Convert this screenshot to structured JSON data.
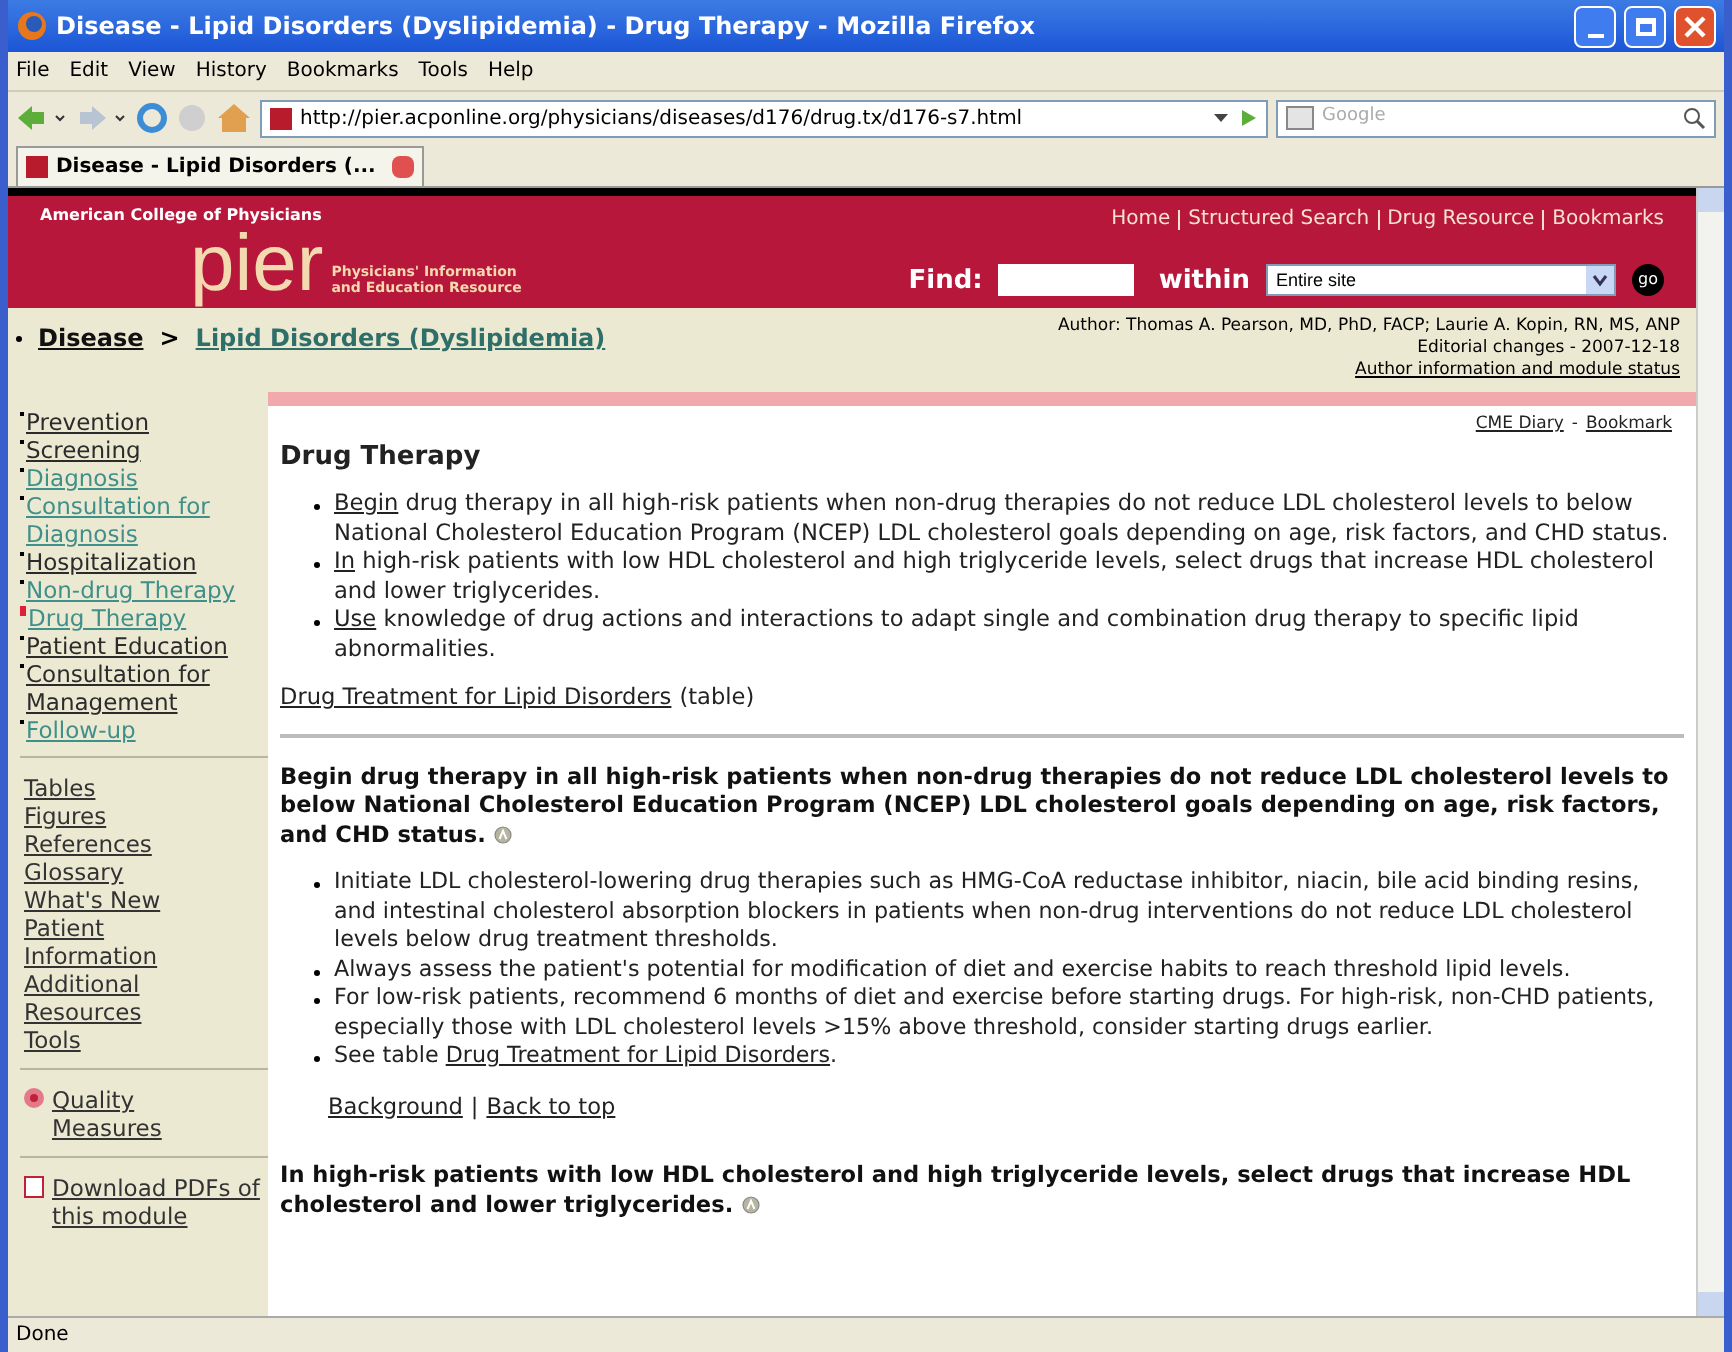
{
  "window": {
    "title": "Disease - Lipid Disorders (Dyslipidemia) - Drug Therapy - Mozilla Firefox"
  },
  "menu": [
    "File",
    "Edit",
    "View",
    "History",
    "Bookmarks",
    "Tools",
    "Help"
  ],
  "toolbar": {
    "url": "http://pier.acponline.org/physicians/diseases/d176/drug.tx/d176-s7.html",
    "search_placeholder": "Google"
  },
  "tabs": [
    {
      "label": "Disease - Lipid Disorders (...",
      "selected": true
    }
  ],
  "header": {
    "org": "American College of Physicians",
    "logo": "pier",
    "tagline": [
      "Physicians' Information",
      "and Education Resource"
    ],
    "top_links": [
      "Home",
      "Structured Search",
      "Drug Resource",
      "Bookmarks"
    ],
    "find_label": "Find:",
    "within_label": "within",
    "scope": "Entire site",
    "go": "go"
  },
  "breadcrumb": {
    "parent": "Disease",
    "separator": ">",
    "current": "Lipid Disorders (Dyslipidemia)"
  },
  "module_info": {
    "author": "Author: Thomas A. Pearson, MD, PhD, FACP; Laurie A. Kopin, RN, MS, ANP",
    "changes": "Editorial changes - 2007-12-18",
    "status_link": "Author information and module status"
  },
  "sidebar": {
    "sections": [
      {
        "label": "Prevention",
        "visited": true,
        "selected": false
      },
      {
        "label": "Screening",
        "visited": true,
        "selected": false
      },
      {
        "label": "Diagnosis",
        "visited": false,
        "selected": false
      },
      {
        "label": "Consultation for Diagnosis",
        "visited": false,
        "selected": false
      },
      {
        "label": "Hospitalization",
        "visited": true,
        "selected": false
      },
      {
        "label": "Non-drug Therapy",
        "visited": false,
        "selected": false
      },
      {
        "label": "Drug Therapy",
        "visited": false,
        "selected": true
      },
      {
        "label": "Patient Education",
        "visited": true,
        "selected": false
      },
      {
        "label": "Consultation for Management",
        "visited": true,
        "selected": false
      },
      {
        "label": "Follow-up",
        "visited": false,
        "selected": false
      }
    ],
    "resources": [
      "Tables",
      "Figures",
      "References",
      "Glossary",
      "What's New",
      "Patient Information",
      "Additional Resources",
      "Tools"
    ],
    "quality": "Quality Measures",
    "download": "Download PDFs of this module"
  },
  "content": {
    "utility_links": [
      "CME Diary",
      "Bookmark"
    ],
    "utility_separator": "-",
    "title": "Drug Therapy",
    "summary": [
      {
        "link": "Begin",
        "text": " drug therapy in all high-risk patients when non-drug therapies do not reduce LDL cholesterol levels to below National Cholesterol Education Program (NCEP) LDL cholesterol goals depending on age, risk factors, and CHD status."
      },
      {
        "link": "In",
        "text": " high-risk patients with low HDL cholesterol and high triglyceride levels, select drugs that increase HDL cholesterol and lower triglycerides."
      },
      {
        "link": "Use",
        "text": " knowledge of drug actions and interactions to adapt single and combination drug therapy to specific lipid abnormalities."
      }
    ],
    "table_link": "Drug Treatment for Lipid Disorders",
    "table_note": "(table)",
    "recommendations": [
      {
        "heading": "Begin drug therapy in all high-risk patients when non-drug therapies do not reduce LDL cholesterol levels to below National Cholesterol Education Program (NCEP) LDL cholesterol goals depending on age, risk factors, and CHD status.",
        "points": [
          {
            "text": "Initiate LDL cholesterol-lowering drug therapies such as HMG-CoA reductase inhibitor, niacin, bile acid binding resins, and intestinal cholesterol absorption blockers in patients when non-drug interventions do not reduce LDL cholesterol levels below drug treatment thresholds."
          },
          {
            "text": "Always assess the patient's potential for modification of diet and exercise habits to reach threshold lipid levels."
          },
          {
            "text": "For low-risk patients, recommend 6 months of diet and exercise before starting drugs. For high-risk, non-CHD patients, especially those with LDL cholesterol levels >15% above threshold, consider starting drugs earlier."
          },
          {
            "text": "See table ",
            "link": "Drug Treatment for Lipid Disorders",
            "after": "."
          }
        ],
        "links": [
          "Background",
          "Back to top"
        ],
        "links_separator": "|"
      },
      {
        "heading": "In high-risk patients with low HDL cholesterol and high triglyceride levels, select drugs that increase HDL cholesterol and lower triglycerides."
      }
    ]
  },
  "status_bar": "Done"
}
